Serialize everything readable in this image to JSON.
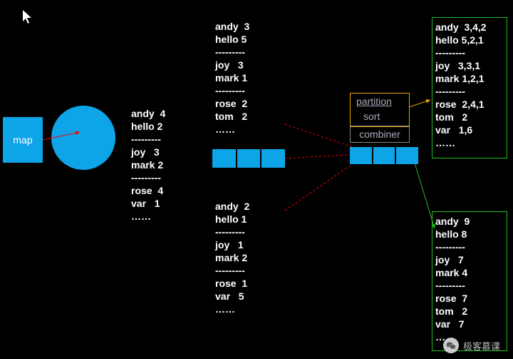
{
  "labels": {
    "map": "map",
    "partition": "partition",
    "sort": "sort",
    "combiner": "combiner",
    "watermark": "极客慕课"
  },
  "left_col": "andy  4\nhello 2\n---------\njoy   3\nmark 2\n---------\nrose  4\nvar   1\n……",
  "mid_top": "andy  3\nhello 5\n---------\njoy   3\nmark 1\n---------\nrose  2\ntom   2\n……",
  "mid_mid": "andy  2\nhello 1\n---------\njoy   1\nmark 2\n---------\nrose  1\nvar   5\n……",
  "right_top": "andy  3,4,2\nhello 5,2,1\n---------\njoy   3,3,1\nmark 1,2,1\n---------\nrose  2,4,1\ntom   2\nvar   1,6\n……",
  "right_bot": "andy  9\nhello 8\n---------\njoy   7\nmark 4\n---------\nrose  7\ntom   2\nvar   7\n……",
  "colors": {
    "green": "#1fbf1f",
    "orange": "#e6a300",
    "red": "#ff0000"
  }
}
